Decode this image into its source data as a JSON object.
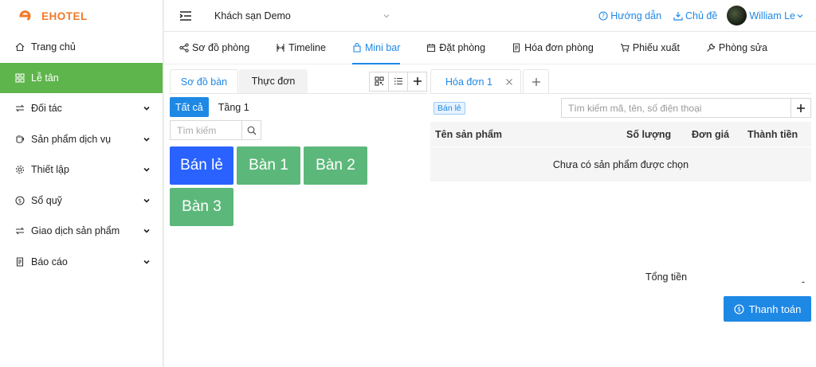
{
  "app": {
    "logo": "EHOTEL",
    "brand_color": "#f07a28"
  },
  "sidebar": {
    "items": [
      {
        "label": "Trang chủ",
        "icon": "home-icon",
        "active": false,
        "expandable": false
      },
      {
        "label": "Lễ tân",
        "icon": "grid-icon",
        "active": true,
        "expandable": false
      },
      {
        "label": "Đối tác",
        "icon": "swap-icon",
        "active": false,
        "expandable": true
      },
      {
        "label": "Sản phẩm dịch vụ",
        "icon": "cup-icon",
        "active": false,
        "expandable": true
      },
      {
        "label": "Thiết lập",
        "icon": "gear-icon",
        "active": false,
        "expandable": true
      },
      {
        "label": "Sổ quỹ",
        "icon": "dollar-icon",
        "active": false,
        "expandable": true
      },
      {
        "label": "Giao dịch sản phẩm",
        "icon": "swap-icon",
        "active": false,
        "expandable": true
      },
      {
        "label": "Báo cáo",
        "icon": "report-icon",
        "active": false,
        "expandable": true
      }
    ]
  },
  "topbar": {
    "hotel": "Khách sạn Demo",
    "help": "Hướng dẫn",
    "theme": "Chủ đề",
    "user": "William Le"
  },
  "tabs": [
    "Sơ đồ phòng",
    "Timeline",
    "Mini bar",
    "Đặt phòng",
    "Hóa đơn phòng",
    "Phiếu xuất",
    "Phòng sửa"
  ],
  "active_tab": "Mini bar",
  "left": {
    "tabs": [
      "Sơ đồ bàn",
      "Thực đơn"
    ],
    "filters": [
      "Tất cả",
      "Tầng 1"
    ],
    "search_placeholder": "Tìm kiếm",
    "tables": [
      {
        "label": "Bán lẻ",
        "color": "blue"
      },
      {
        "label": "Bàn 1",
        "color": "green"
      },
      {
        "label": "Bàn 2",
        "color": "green"
      },
      {
        "label": "Bàn 3",
        "color": "green"
      }
    ]
  },
  "right": {
    "invoice_tab": "Hóa đơn 1",
    "badge": "Bán lẻ",
    "search_placeholder": "Tìm kiếm mã, tên, số điện thoại",
    "columns": [
      "Tên sản phẩm",
      "Số lượng",
      "Đơn giá",
      "Thành tiền"
    ],
    "empty": "Chưa có sản phẩm được chọn",
    "total_label": "Tổng tiền",
    "total_value": "-",
    "pay_button": "Thanh toán"
  }
}
